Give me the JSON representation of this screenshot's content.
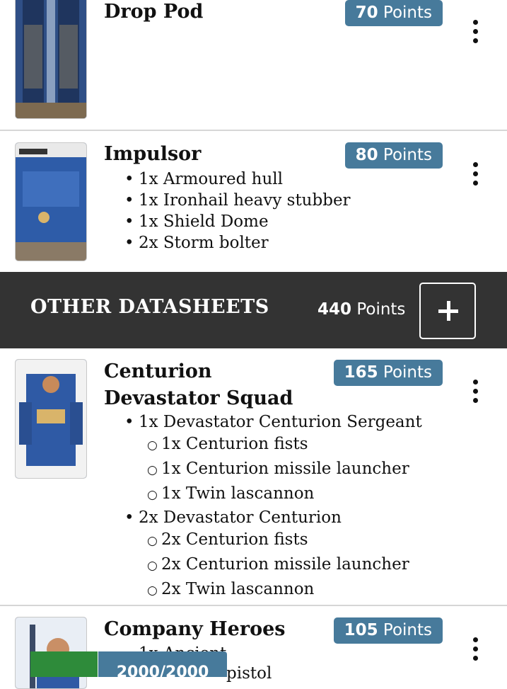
{
  "units": [
    {
      "name": "Drop Pod",
      "points_value": "70",
      "points_unit": "Points",
      "loadout": []
    },
    {
      "name": "Impulsor",
      "points_value": "80",
      "points_unit": "Points",
      "loadout": [
        "1x Armoured hull",
        "1x Ironhail heavy stubber",
        "1x Shield Dome",
        "2x Storm bolter"
      ]
    }
  ],
  "section": {
    "title": "OTHER DATASHEETS",
    "points_value": "440",
    "points_unit": "Points",
    "add_icon": "plus-icon"
  },
  "centurion": {
    "name_line1": "Centurion",
    "name_line2": "Devastator Squad",
    "points_value": "165",
    "points_unit": "Points",
    "groups": [
      {
        "label": "1x Devastator Centurion Sergeant",
        "items": [
          "1x Centurion fists",
          "1x Centurion missile launcher",
          "1x Twin lascannon"
        ]
      },
      {
        "label": "2x Devastator Centurion",
        "items": [
          "2x Centurion fists",
          "2x Centurion missile launcher",
          "2x Twin lascannon"
        ]
      }
    ]
  },
  "heroes": {
    "name": "Company Heroes",
    "points_value": "105",
    "points_unit": "Points",
    "partial_line1": "1x Ancient",
    "partial_line2": "pistol"
  },
  "bottom_bar": {
    "count_text": "2000/2000"
  },
  "icons": {
    "menu": "more-vertical-icon",
    "bullet": "•",
    "sub_bullet": "○"
  },
  "colors": {
    "badge": "#477a9b",
    "section_bg": "#333333",
    "green": "#2e8b3a"
  }
}
